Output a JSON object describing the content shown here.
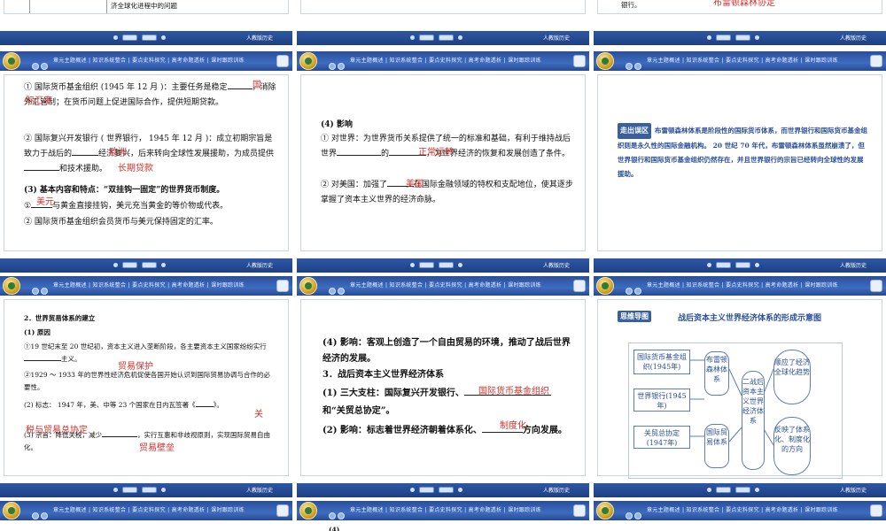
{
  "nav_text": "章元主题概述 | 知识系统整合 | 要点史料探究 | 高考命题透析 | 课时跟踪训练",
  "publisher": "人教版历史",
  "r0": {
    "c0_text": "济全球化进程中的问题",
    "c2_text": "银行。",
    "c2_ans": "布雷顿森林协定"
  },
  "r1": {
    "c0": {
      "p1a": "① 国际货币基金组织 (1945 年 12 月 )：主要任务是稳定",
      "p1b": "，消除外汇管制；在货币问题上促进国际合作，提供短期贷款。",
      "ans1a": "国",
      "ans1b": "际汇率",
      "p2a": "② 国际复兴开发银行 ( 世界银行， 1945 年 12 月 )：成立初期宗旨是致力于战后的",
      "p2b": "经济复兴，后来转向全球性发展援助，为成员提供",
      "p2c": "和技术援助。",
      "ans2a": "欧洲",
      "ans2b": "长期贷款",
      "p3": "(3) 基本内容和特点：“双挂钩一固定”的世界货币制度。",
      "p4a": "①",
      "p4b": "与黄金直接挂钩，美元充当黄金的等价物或代表。",
      "ans4": "美元",
      "p5": "② 国际货币基金组织会员货币与美元保持固定的汇率。"
    },
    "c1": {
      "h": "(4) 影响",
      "p1a": "① 对世界：为世界货币关系提供了统一的标准和基础，有利于维持战后世界",
      "p1b": "的",
      "p1c": "，为世界经济的恢复和发展创造了条件。",
      "ans1": "正常运转",
      "p2a": "② 对美国：加强了",
      "p2b": "在国际金融领域的特权和支配地位，使其逐步掌握了资本主义世界的经济命脉。",
      "ans2": "美国"
    },
    "c2": {
      "tag": "走出误区",
      "text": "布雷顿森林体系是阶段性的国际货币体系，而世界银行和国际货币基金组织则是永久性的国际金融机构。 20 世纪 70 年代，布雷顿森林体系虽然崩溃了，但世界银行和国际货币基金组织仍然存在，并且世界银行的宗旨已经转向全球性的发展援助。"
    }
  },
  "r2": {
    "c0": {
      "h": "2．世界贸易体系的建立",
      "sub1": "(1) 原因",
      "p1a": "①19 世纪末至 20 世纪初，资本主义进入垄断阶段，各主要资本主义国家纷纷实行",
      "p1b": "主义。",
      "ans1": "贸易保护",
      "p2": "②1929 ～ 1933 年的世界性经济危机促使各国开始认识到国际贸易协调与合作的必要性。",
      "p3a": "(2) 标志： 1947 年，美、中等 23 个国家在日内瓦签署《",
      "p3b": "》。",
      "ans3a": "关",
      "ans3b": "税与贸易总协定",
      "p4a": "(3) 宗旨：降低关税，减少",
      "p4b": "，实行互惠和非歧视原则，实现国际贸易自由化。",
      "ans4": "贸易壁垒"
    },
    "c1": {
      "p1": "(4) 影响：客观上创造了一个自由贸易的环境，推动了战后世界经济的发展。",
      "h3": "3．战后资本主义世界经济体系",
      "p2a": "(1) 三大支柱：国际复兴开发银行、",
      "ans2": "国际货币基金组织",
      "p2b": "和“关贸总协定”。",
      "p3a": "(2) 影响：标志着世界经济朝着体系化、",
      "ans3": "制度化",
      "p3b": "方向发展。"
    },
    "c2": {
      "tag": "思维导图",
      "title": "战后资本主义世界经济体系的形成示意图",
      "n_imf": "国际货币基金组织(1945年)",
      "n_wb": "世界银行(1945年)",
      "n_gatt": "关贸总协定(1947年)",
      "n_bw": "布雷顿森林体系",
      "n_trade": "国际贸易体系",
      "n_center": "二战后资本主义世界经济体系",
      "n_r1": "顺应了经济全球化趋势",
      "n_r2": "反映了体系化、制度化的方向"
    }
  },
  "r3": {
    "c1_text": "(4)"
  }
}
